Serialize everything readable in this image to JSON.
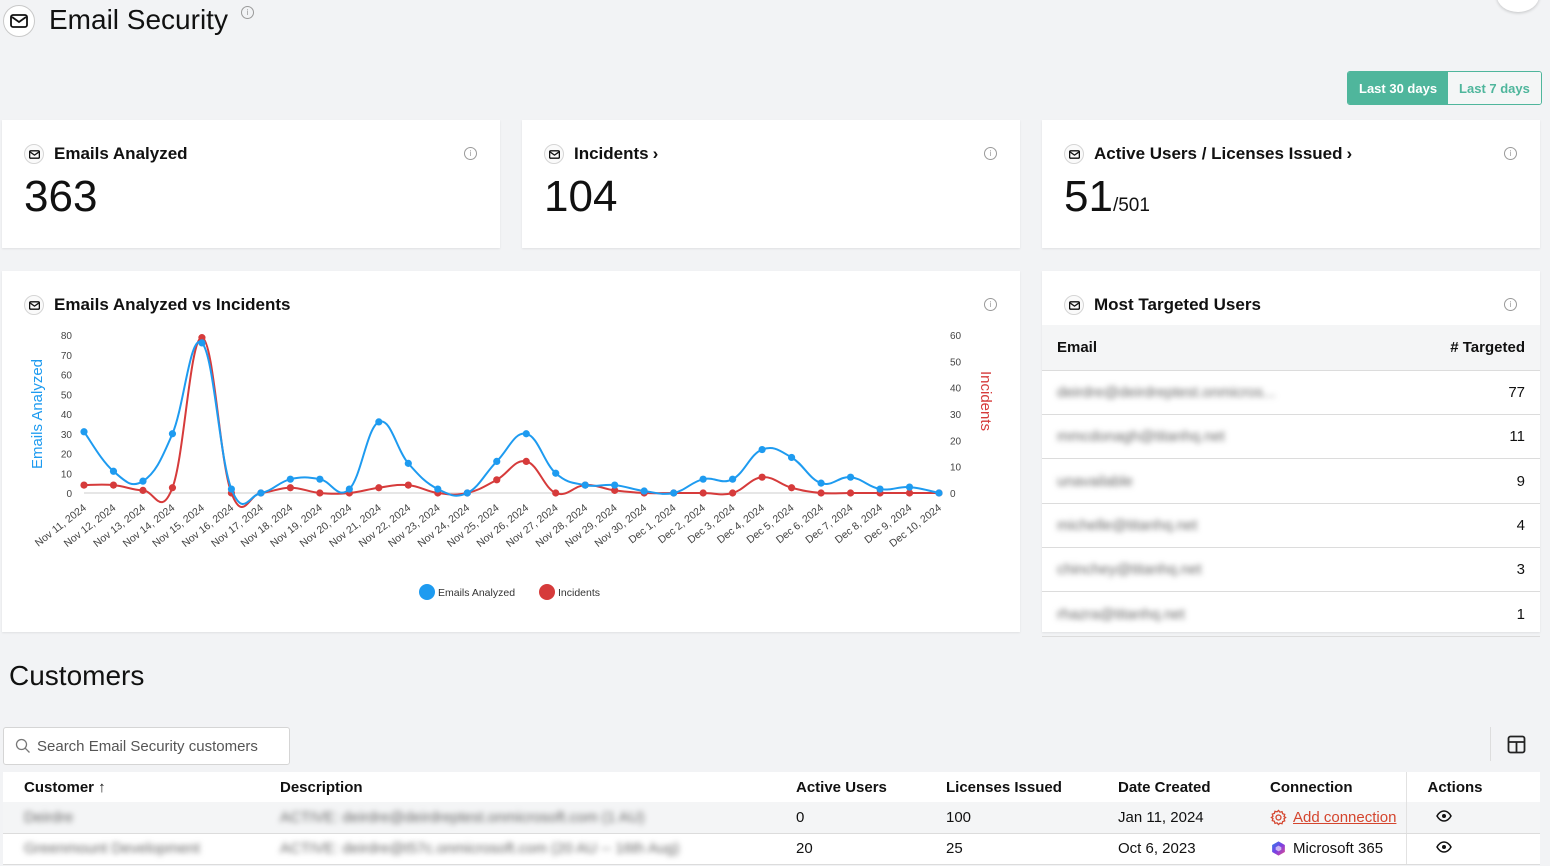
{
  "header": {
    "title": "Email Security",
    "title_icon": "envelope-icon"
  },
  "date_range": {
    "options": [
      "Last 30 days",
      "Last 7 days"
    ],
    "selected": "Last 30 days"
  },
  "stats": {
    "emails_analyzed": {
      "label": "Emails Analyzed",
      "value": "363"
    },
    "incidents": {
      "label": "Incidents",
      "value": "104",
      "chevron": "›"
    },
    "active_users": {
      "label": "Active Users / Licenses Issued",
      "value": "51",
      "total": "/501",
      "chevron": "›"
    }
  },
  "chart_card": {
    "title": "Emails Analyzed vs Incidents"
  },
  "chart_data": {
    "type": "line",
    "title": "Emails Analyzed vs Incidents",
    "x": [
      "Nov 11, 2024",
      "Nov 12, 2024",
      "Nov 13, 2024",
      "Nov 14, 2024",
      "Nov 15, 2024",
      "Nov 16, 2024",
      "Nov 17, 2024",
      "Nov 18, 2024",
      "Nov 19, 2024",
      "Nov 20, 2024",
      "Nov 21, 2024",
      "Nov 22, 2024",
      "Nov 23, 2024",
      "Nov 24, 2024",
      "Nov 25, 2024",
      "Nov 26, 2024",
      "Nov 27, 2024",
      "Nov 28, 2024",
      "Nov 29, 2024",
      "Nov 30, 2024",
      "Dec 1, 2024",
      "Dec 2, 2024",
      "Dec 3, 2024",
      "Dec 4, 2024",
      "Dec 5, 2024",
      "Dec 6, 2024",
      "Dec 7, 2024",
      "Dec 8, 2024",
      "Dec 9, 2024",
      "Dec 10, 2024"
    ],
    "series": [
      {
        "name": "Emails Analyzed",
        "axis": "left",
        "color": "#1e9bf0",
        "values": [
          31,
          11,
          6,
          30,
          76,
          2,
          0,
          7,
          7,
          2,
          36,
          15,
          2,
          0,
          16,
          30,
          10,
          4,
          4,
          1,
          0,
          7,
          7,
          22,
          18,
          5,
          8,
          2,
          3,
          0
        ]
      },
      {
        "name": "Incidents",
        "axis": "right",
        "color": "#d63b3b",
        "values": [
          3,
          3,
          1,
          2,
          59,
          0,
          0,
          2,
          0,
          0,
          2,
          3,
          0,
          0,
          5,
          12,
          0,
          3,
          1,
          0,
          0,
          0,
          0,
          6,
          2,
          0,
          0,
          0,
          0,
          0
        ]
      }
    ],
    "ylabel": "Emails Analyzed",
    "y2label": "Incidents",
    "ylim": [
      0,
      80
    ],
    "y2lim": [
      0,
      60
    ],
    "yticks": [
      0,
      10,
      20,
      30,
      40,
      50,
      60,
      70,
      80
    ],
    "y2ticks": [
      0,
      10,
      20,
      30,
      40,
      50,
      60
    ],
    "legend": "bottom-center",
    "grid": false
  },
  "most_targeted": {
    "title": "Most Targeted Users",
    "columns": [
      "Email",
      "# Targeted"
    ],
    "rows": [
      {
        "email": "deirdre@deirdreptest.onmicros...",
        "count": "77"
      },
      {
        "email": "mmcdonagh@titanhq.net",
        "count": "11"
      },
      {
        "email": "unavailable",
        "count": "9"
      },
      {
        "email": "michelle@titanhq.net",
        "count": "4"
      },
      {
        "email": "chinchey@titanhq.net",
        "count": "3"
      },
      {
        "email": "rhazra@titanhq.net",
        "count": "1"
      }
    ]
  },
  "customers": {
    "title": "Customers",
    "search_placeholder": "Search Email Security customers",
    "columns": [
      "Customer ↑",
      "Description",
      "Active Users",
      "Licenses Issued",
      "Date Created",
      "Connection",
      "Actions"
    ],
    "rows": [
      {
        "customer": "Deirdre",
        "description": "ACTIVE: deirdre@deirdreptest.onmicrosoft.com (1 AU)",
        "active_users": "0",
        "licenses": "100",
        "date": "Jan 11, 2024",
        "connection": "Add connection",
        "connection_type": "add"
      },
      {
        "customer": "Greenmount Development",
        "description": "ACTIVE: deirdre@t57c.onmicrosoft.com (20 AU -- 16th Aug)",
        "active_users": "20",
        "licenses": "25",
        "date": "Oct 6, 2023",
        "connection": "Microsoft 365",
        "connection_type": "m365"
      }
    ]
  }
}
